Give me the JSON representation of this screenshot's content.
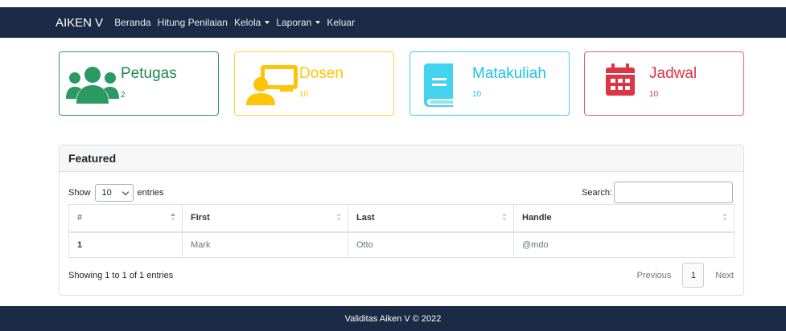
{
  "navbar": {
    "brand": "AIKEN V",
    "items": [
      {
        "label": "Beranda",
        "dropdown": false
      },
      {
        "label": "Hitung Penilaian",
        "dropdown": false
      },
      {
        "label": "Kelola",
        "dropdown": true
      },
      {
        "label": "Laporan",
        "dropdown": true
      },
      {
        "label": "Keluar",
        "dropdown": false
      }
    ]
  },
  "cards": [
    {
      "title": "Petugas",
      "count": "2",
      "icon": "users-icon",
      "color": "#1e8a4f"
    },
    {
      "title": "Dosen",
      "count": "10",
      "icon": "teacher-icon",
      "color": "#fdc509"
    },
    {
      "title": "Matakuliah",
      "count": "10",
      "icon": "book-icon",
      "color": "#1fc2e6"
    },
    {
      "title": "Jadwal",
      "count": "10",
      "icon": "calendar-icon",
      "color": "#dc3545"
    }
  ],
  "panel": {
    "title": "Featured",
    "length": {
      "prefix": "Show",
      "value": "10",
      "suffix": "entries"
    },
    "search_label": "Search:",
    "search_value": "",
    "columns": [
      "#",
      "First",
      "Last",
      "Handle"
    ],
    "rows": [
      {
        "num": "1",
        "first": "Mark",
        "last": "Otto",
        "handle": "@mdo"
      }
    ],
    "info": "Showing 1 to 1 of 1 entries",
    "pager": {
      "previous": "Previous",
      "current": "1",
      "next": "Next"
    }
  },
  "footer": {
    "text": "Validitas Aiken V © 2022"
  }
}
